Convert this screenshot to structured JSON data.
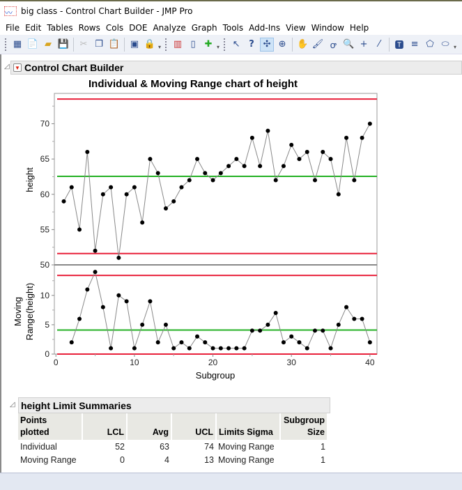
{
  "window": {
    "title": "big class - Control Chart Builder - JMP Pro"
  },
  "menu": [
    "File",
    "Edit",
    "Tables",
    "Rows",
    "Cols",
    "DOE",
    "Analyze",
    "Graph",
    "Tools",
    "Add-Ins",
    "View",
    "Window",
    "Help"
  ],
  "toolbar": {
    "icons": [
      "new-data-table-icon",
      "new-script-icon",
      "open-icon",
      "save-icon",
      "cut-icon",
      "copy-icon",
      "paste-icon",
      "journal-icon",
      "lock-icon",
      "data-table-icon",
      "column-icon",
      "add-rows-icon",
      "arrow-icon",
      "help-icon",
      "selection-icon",
      "crosshair-target-icon",
      "grabber-icon",
      "brush-icon",
      "lasso-icon",
      "magnifier-icon",
      "crosshair-icon",
      "line-icon",
      "text-annotation-icon",
      "line-arrow-icon",
      "polygon-icon",
      "oval-icon"
    ]
  },
  "report": {
    "title": "Control Chart Builder"
  },
  "chart_data": {
    "type": "line",
    "title": "Individual & Moving Range chart of height",
    "xlabel": "Subgroup",
    "x_ticks": [
      "0",
      "10",
      "20",
      "30",
      "40"
    ],
    "xlim": [
      -0.2,
      40.9
    ],
    "charts": [
      {
        "name": "Individual",
        "ylabel": "height",
        "ylim": [
          50,
          74.3
        ],
        "y_ticks": [
          "50",
          "55",
          "60",
          "65",
          "70"
        ],
        "values": [
          59,
          61,
          55,
          66,
          52,
          60,
          61,
          51,
          60,
          61,
          56,
          65,
          63,
          58,
          59,
          61,
          62,
          65,
          63,
          62,
          63,
          64,
          65,
          64,
          68,
          64,
          69,
          62,
          64,
          67,
          65,
          66,
          62,
          66,
          65,
          60,
          68,
          62,
          68,
          70
        ],
        "lcl": 51.6,
        "avg": 62.55,
        "ucl": 73.5
      },
      {
        "name": "Moving Range",
        "ylabel": "Moving Range(height)",
        "ylim": [
          0,
          15.2
        ],
        "y_ticks": [
          "0",
          "5",
          "10"
        ],
        "values": [
          null,
          2,
          6,
          11,
          14,
          8,
          1,
          10,
          9,
          1,
          5,
          9,
          2,
          5,
          1,
          2,
          1,
          3,
          2,
          1,
          1,
          1,
          1,
          1,
          4,
          4,
          5,
          7,
          2,
          3,
          2,
          1,
          4,
          4,
          1,
          5,
          8,
          6,
          6,
          2
        ],
        "lcl": 0,
        "avg": 4.1,
        "ucl": 13.4
      }
    ],
    "colors": {
      "limit": "#e8203a",
      "center": "#22b022",
      "line": "#888888",
      "point": "#000000"
    }
  },
  "summary": {
    "title": "height Limit Summaries",
    "headers": [
      "Points plotted",
      "LCL",
      "Avg",
      "UCL",
      "Limits Sigma",
      "Subgroup Size"
    ],
    "rows": [
      [
        "Individual",
        "52",
        "63",
        "74",
        "Moving Range",
        "1"
      ],
      [
        "Moving Range",
        "0",
        "4",
        "13",
        "Moving Range",
        "1"
      ]
    ]
  }
}
